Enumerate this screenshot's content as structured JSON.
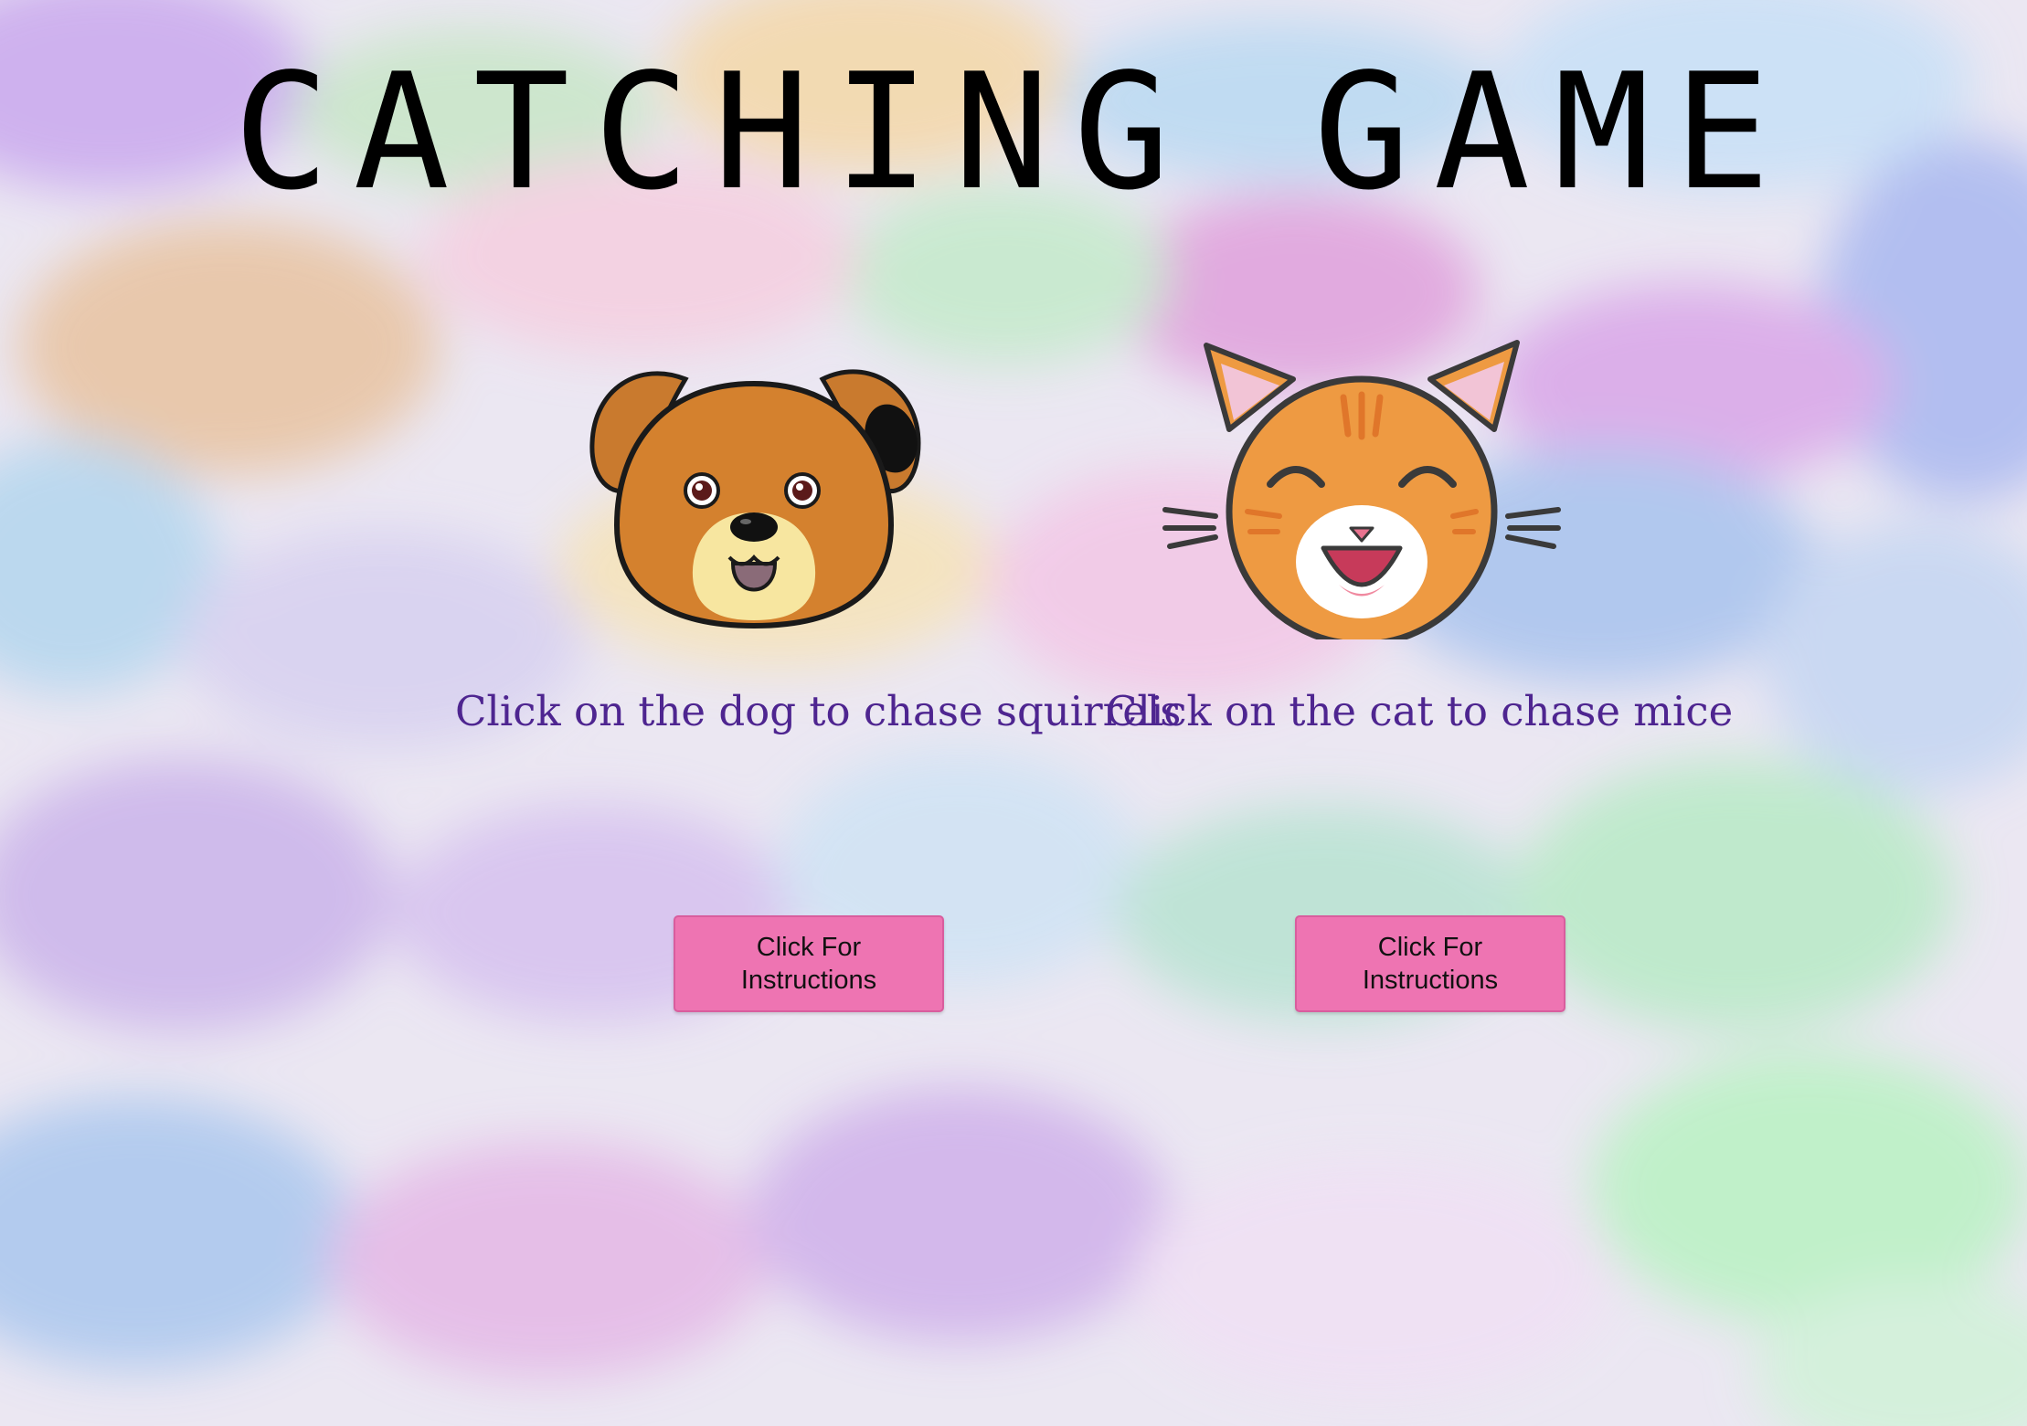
{
  "title": "CATCHING GAME",
  "dog": {
    "image": "dog-face-icon",
    "caption": "Click on the dog to chase squirrels",
    "button_label": "Click For Instructions"
  },
  "cat": {
    "image": "cat-face-icon",
    "caption": "Click on the cat to chase mice",
    "button_label": "Click For Instructions"
  },
  "colors": {
    "caption_text": "#4e2590",
    "button_bg": "#ee74b2",
    "title_text": "#000000",
    "dog_fur": "#d4812e",
    "cat_fur": "#ee9a42"
  }
}
